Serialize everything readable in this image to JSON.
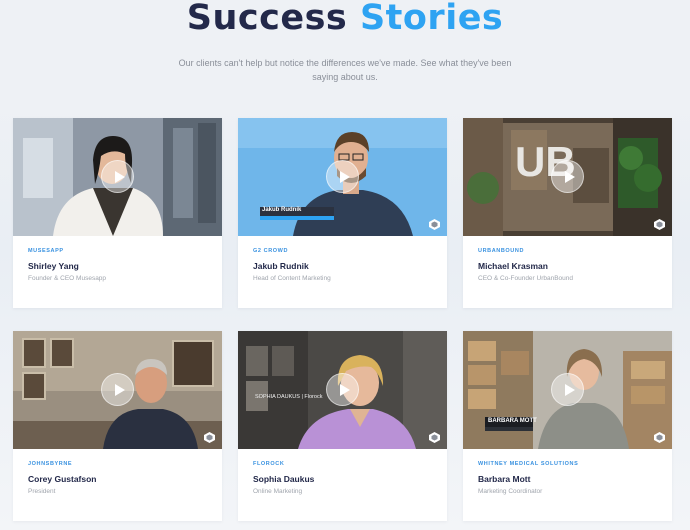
{
  "heading": {
    "word1": "Success",
    "word2": "Stories"
  },
  "subtitle": "Our clients can't help but notice the differences we've made. See what they've been saying about us.",
  "colors": {
    "navy": "#23294a",
    "accent": "#2ea3f2"
  },
  "stories": [
    {
      "company": "MUSESAPP",
      "name": "Shirley Yang",
      "role": "Founder & CEO Musesapp"
    },
    {
      "company": "G2 CROWD",
      "name": "Jakub Rudnik",
      "role": "Head of Content Marketing",
      "caption": "Jakub Rudnik"
    },
    {
      "company": "URBANBOUND",
      "name": "Michael Krasman",
      "role": "CEO & Co-Founder UrbanBound",
      "sign": "UB"
    },
    {
      "company": "JOHNSBYRNE",
      "name": "Corey Gustafson",
      "role": "President"
    },
    {
      "company": "FLOROCK",
      "name": "Sophia Daukus",
      "role": "Online Marketing",
      "caption": "SOPHIA DAUKUS | Florock"
    },
    {
      "company": "WHITNEY MEDICAL SOLUTIONS",
      "name": "Barbara Mott",
      "role": "Marketing Coordinator",
      "caption": "BARBARA MOTT"
    }
  ],
  "icons": {
    "play": "play-icon",
    "badge": "brand-badge-icon"
  }
}
